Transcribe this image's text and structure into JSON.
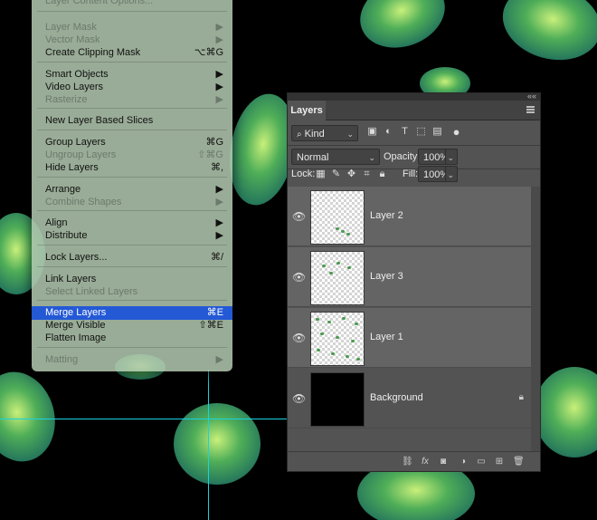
{
  "menu": {
    "items": [
      {
        "label": "Layer Content Options...",
        "shortcut": "",
        "disabled": true
      },
      {
        "label": "Layer Mask",
        "shortcut": "▶",
        "disabled": true
      },
      {
        "label": "Vector Mask",
        "shortcut": "▶",
        "disabled": true
      },
      {
        "label": "Create Clipping Mask",
        "shortcut": "⌥⌘G",
        "disabled": false
      },
      {
        "label": "Smart Objects",
        "shortcut": "▶",
        "disabled": false
      },
      {
        "label": "Video Layers",
        "shortcut": "▶",
        "disabled": false
      },
      {
        "label": "Rasterize",
        "shortcut": "▶",
        "disabled": true
      },
      {
        "label": "New Layer Based Slices",
        "shortcut": "",
        "disabled": false
      },
      {
        "label": "Group Layers",
        "shortcut": "⌘G",
        "disabled": false
      },
      {
        "label": "Ungroup Layers",
        "shortcut": "⇧⌘G",
        "disabled": true
      },
      {
        "label": "Hide Layers",
        "shortcut": "⌘,",
        "disabled": false
      },
      {
        "label": "Arrange",
        "shortcut": "▶",
        "disabled": false
      },
      {
        "label": "Combine Shapes",
        "shortcut": "▶",
        "disabled": true
      },
      {
        "label": "Align",
        "shortcut": "▶",
        "disabled": false
      },
      {
        "label": "Distribute",
        "shortcut": "▶",
        "disabled": false
      },
      {
        "label": "Lock Layers...",
        "shortcut": "⌘/",
        "disabled": false
      },
      {
        "label": "Link Layers",
        "shortcut": "",
        "disabled": false
      },
      {
        "label": "Select Linked Layers",
        "shortcut": "",
        "disabled": true
      },
      {
        "label": "Merge Layers",
        "shortcut": "⌘E",
        "disabled": false,
        "selected": true
      },
      {
        "label": "Merge Visible",
        "shortcut": "⇧⌘E",
        "disabled": false
      },
      {
        "label": "Flatten Image",
        "shortcut": "",
        "disabled": false
      },
      {
        "label": "Matting",
        "shortcut": "▶",
        "disabled": true
      }
    ]
  },
  "panel": {
    "tab_label": "Layers",
    "filter": {
      "kind_label": "Kind"
    },
    "blend_mode": "Normal",
    "opacity_label": "Opacity:",
    "opacity_value": "100%",
    "lock_label": "Lock:",
    "fill_label": "Fill:",
    "fill_value": "100%",
    "layers": [
      {
        "name": "Layer 2",
        "visible": true
      },
      {
        "name": "Layer 3",
        "visible": true
      },
      {
        "name": "Layer 1",
        "visible": true
      },
      {
        "name": "Background",
        "visible": true,
        "locked": true
      }
    ]
  },
  "colors": {
    "selection": "#2459d6",
    "guide": "#19d3e0",
    "panel": "#535353",
    "leaf_green": "#4a9b4f"
  }
}
